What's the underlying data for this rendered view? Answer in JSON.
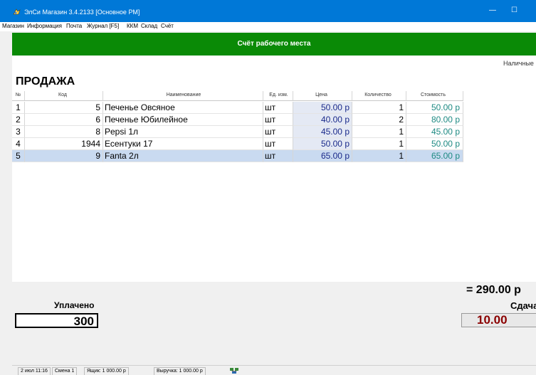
{
  "window": {
    "title": "ЭлСи Магазин 3.4.2133 [Основное РМ]",
    "minimize_glyph": "—",
    "maximize_glyph": "☐"
  },
  "menu": [
    "Магазин",
    "Информация",
    "Почта",
    "Журнал [F5]",
    "ККМ",
    "Склад",
    "Счёт"
  ],
  "header": {
    "title": "Счёт рабочего места"
  },
  "payment_method": "Наличные",
  "section_title": "ПРОДАЖА",
  "table": {
    "columns": [
      "№",
      "Код",
      "Наименование",
      "Ед. изм.",
      "Цена",
      "Количество",
      "Стоимость"
    ],
    "rows": [
      {
        "num": "1",
        "code": "5",
        "name": "Печенье Овсяное",
        "unit": "шт",
        "price": "50.00 р",
        "qty": "1",
        "cost": "50.00 р"
      },
      {
        "num": "2",
        "code": "6",
        "name": "Печенье Юбилейное",
        "unit": "шт",
        "price": "40.00 р",
        "qty": "2",
        "cost": "80.00 р"
      },
      {
        "num": "3",
        "code": "8",
        "name": "Pepsi 1л",
        "unit": "шт",
        "price": "45.00 р",
        "qty": "1",
        "cost": "45.00 р"
      },
      {
        "num": "4",
        "code": "1944",
        "name": "Есентуки 17",
        "unit": "шт",
        "price": "50.00 р",
        "qty": "1",
        "cost": "50.00 р"
      },
      {
        "num": "5",
        "code": "9",
        "name": "Fanta 2л",
        "unit": "шт",
        "price": "65.00 р",
        "qty": "1",
        "cost": "65.00 р"
      }
    ],
    "selected_row": 5
  },
  "totals": {
    "total": "= 290.00 р",
    "change_label": "Сдача",
    "change_value": "10.00",
    "paid_label": "Уплачено",
    "paid_value": "300"
  },
  "status": {
    "datetime": "2 июл 11:16",
    "shift": "Смена 1",
    "drawer": "Ящик: 1 000.00 р",
    "revenue": "Выручка: 1 000.00 р"
  },
  "colors": {
    "titlebar": "#0078d7",
    "header_green": "#0a8a06",
    "price_text": "#1a2a8a",
    "cost_text": "#1e8a83",
    "change_text": "#8a0000",
    "selected_row": "#c9daf0"
  }
}
